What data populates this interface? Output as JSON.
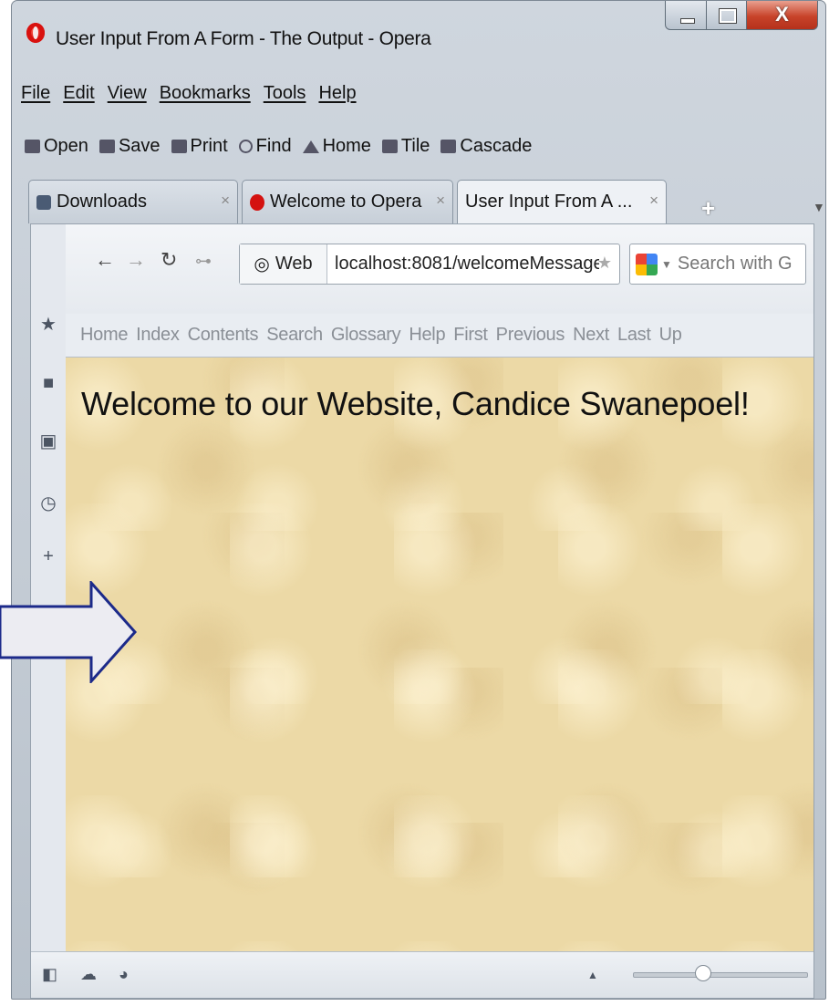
{
  "window": {
    "title": "User Input From A Form - The Output - Opera",
    "close_label": "X"
  },
  "menubar": [
    "File",
    "Edit",
    "View",
    "Bookmarks",
    "Tools",
    "Help"
  ],
  "toolbar": {
    "open": "Open",
    "save": "Save",
    "print": "Print",
    "find": "Find",
    "home": "Home",
    "tile": "Tile",
    "cascade": "Cascade"
  },
  "tabs": [
    {
      "label": "Downloads",
      "close": "×"
    },
    {
      "label": "Welcome to Opera",
      "close": "×"
    },
    {
      "label": "User Input From A ...",
      "close": "×"
    }
  ],
  "newtab_symbol": "+",
  "address": {
    "web_label": "Web",
    "url": "localhost:8081/welcomeMessage",
    "search_placeholder": "Search with G"
  },
  "linkbar": [
    "Home",
    "Index",
    "Contents",
    "Search",
    "Glossary",
    "Help",
    "First",
    "Previous",
    "Next",
    "Last",
    "Up"
  ],
  "page": {
    "message": "Welcome to our Website, Candice Swanepoel!"
  },
  "statusbar": {
    "zoom_fraction": 0.4
  }
}
